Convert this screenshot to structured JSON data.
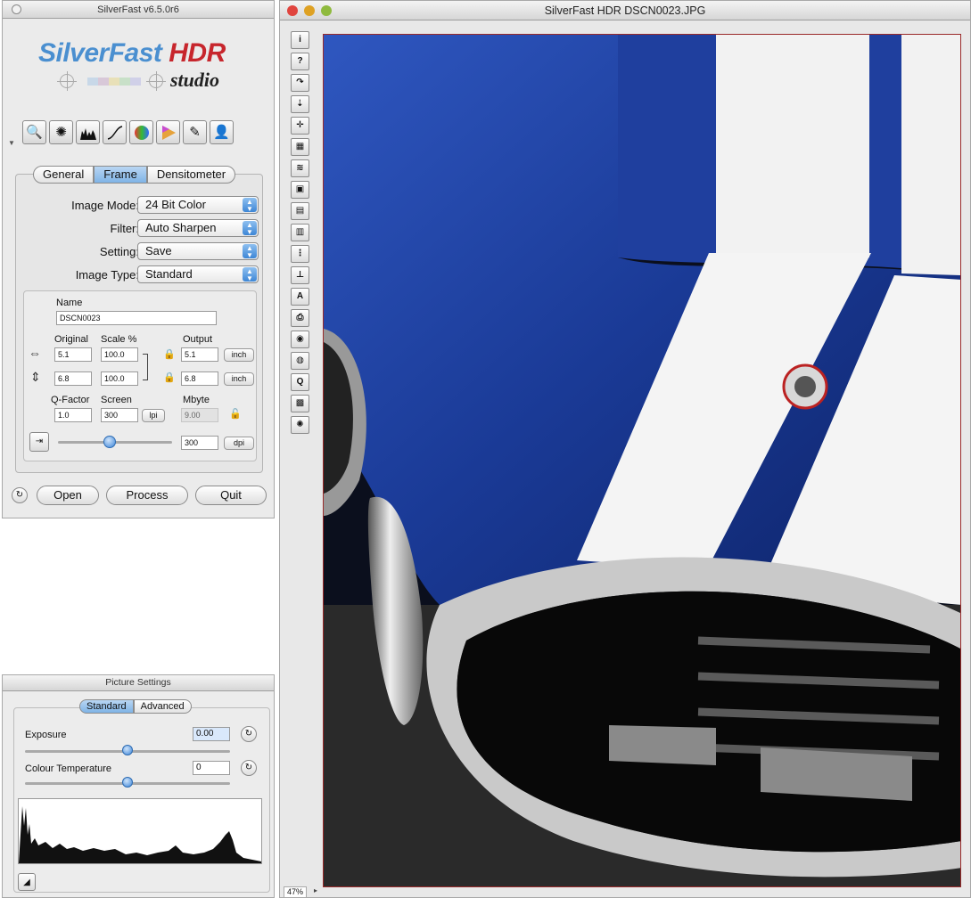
{
  "panel": {
    "title": "SilverFast v6.5.0r6",
    "logo": {
      "line1_a": "SilverFast ",
      "line1_b": "HDR",
      "line2": "studio"
    },
    "toolbar_icons": [
      "zoom-icon",
      "color-correction-icon",
      "histogram-icon",
      "gradation-curve-icon",
      "global-color-icon",
      "selective-color-icon",
      "expert-dialog-icon",
      "jobmanager-icon"
    ],
    "tabs": [
      "General",
      "Frame",
      "Densitometer"
    ],
    "active_tab": "Frame",
    "image_mode": {
      "label": "Image Mode:",
      "value": "24 Bit Color"
    },
    "filter": {
      "label": "Filter:",
      "value": "Auto Sharpen"
    },
    "setting": {
      "label": "Setting:",
      "value": "Save"
    },
    "image_type": {
      "label": "Image Type:",
      "value": "Standard"
    },
    "name": {
      "label": "Name",
      "value": "DSCN0023"
    },
    "headers": {
      "original": "Original",
      "scale": "Scale %",
      "output": "Output"
    },
    "width": {
      "original": "5.1",
      "scale": "100.0",
      "output": "5.1",
      "unit": "inch"
    },
    "height": {
      "original": "6.8",
      "scale": "100.0",
      "output": "6.8",
      "unit": "inch"
    },
    "qfactor": {
      "label": "Q-Factor",
      "value": "1.0"
    },
    "screen": {
      "label": "Screen",
      "value": "300",
      "unit": "lpi"
    },
    "mbyte": {
      "label": "Mbyte",
      "value": "9.00"
    },
    "resolution": {
      "value": "300",
      "unit": "dpi",
      "slider_fraction": 0.45
    },
    "buttons": {
      "open": "Open",
      "process": "Process",
      "quit": "Quit"
    }
  },
  "picture_settings": {
    "title": "Picture Settings",
    "tabs": [
      "Standard",
      "Advanced"
    ],
    "active_tab": "Standard",
    "exposure": {
      "label": "Exposure",
      "value": "0.00",
      "slider_fraction": 0.5
    },
    "colour_temperature": {
      "label": "Colour Temperature",
      "value": "0",
      "slider_fraction": 0.5
    }
  },
  "image_window": {
    "title": "SilverFast HDR DSCN0023.JPG",
    "zoom": "47%",
    "colors": {
      "close": "#e0443e",
      "minimize": "#dea123",
      "zoom": "#8fba3e",
      "car_blue": "#1e3f9c",
      "stripe": "#f4f4f4"
    },
    "tools": [
      {
        "name": "info-icon",
        "glyph": "i"
      },
      {
        "name": "help-icon",
        "glyph": "?"
      },
      {
        "name": "rotate-icon",
        "glyph": "↷"
      },
      {
        "name": "flip-icon",
        "glyph": "⇣"
      },
      {
        "name": "midtone-icon",
        "glyph": "✛"
      },
      {
        "name": "noise-icon",
        "glyph": "▦"
      },
      {
        "name": "gradation-icon",
        "glyph": "≋"
      },
      {
        "name": "frame-icon",
        "glyph": "▣"
      },
      {
        "name": "multiframe-icon",
        "glyph": "▤"
      },
      {
        "name": "copy-frame-icon",
        "glyph": "▥"
      },
      {
        "name": "densitometer-icon",
        "glyph": "⋮"
      },
      {
        "name": "stamp-icon",
        "glyph": "⊥"
      },
      {
        "name": "aaa-icon",
        "glyph": "A"
      },
      {
        "name": "print-icon",
        "glyph": "⎙"
      },
      {
        "name": "eye-icon",
        "glyph": "◉"
      },
      {
        "name": "fine-icon",
        "glyph": "◍"
      },
      {
        "name": "search-icon",
        "glyph": "Q"
      },
      {
        "name": "save-icon",
        "glyph": "▩"
      },
      {
        "name": "lightbulb-icon",
        "glyph": "✺"
      }
    ]
  }
}
